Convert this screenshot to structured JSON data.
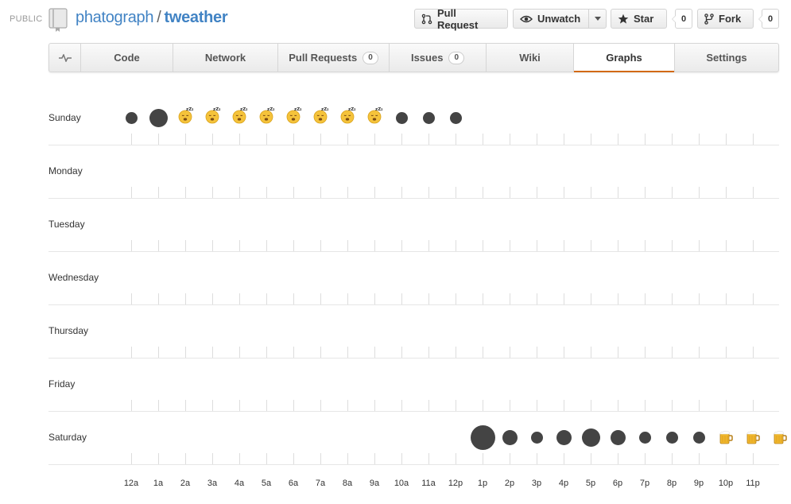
{
  "header": {
    "visibility": "PUBLIC",
    "owner": "phatograph",
    "separator": "/",
    "repo": "tweather",
    "actions": {
      "pull_request": "Pull Request",
      "unwatch": "Unwatch",
      "star": "Star",
      "star_count": "0",
      "fork": "Fork",
      "fork_count": "0"
    }
  },
  "tabs": [
    {
      "label": "",
      "icon": "pulse-icon",
      "count": null,
      "selected": false
    },
    {
      "label": "Code",
      "count": null,
      "selected": false
    },
    {
      "label": "Network",
      "count": null,
      "selected": false
    },
    {
      "label": "Pull Requests",
      "count": "0",
      "selected": false
    },
    {
      "label": "Issues",
      "count": "0",
      "selected": false
    },
    {
      "label": "Wiki",
      "count": null,
      "selected": false
    },
    {
      "label": "Graphs",
      "count": null,
      "selected": true
    },
    {
      "label": "Settings",
      "count": null,
      "selected": false
    }
  ],
  "colors": {
    "accent": "#4183c4",
    "selected_tab": "#d26911",
    "dot": "#444444"
  },
  "chart_data": {
    "type": "scatter",
    "days": [
      "Sunday",
      "Monday",
      "Tuesday",
      "Wednesday",
      "Thursday",
      "Friday",
      "Saturday"
    ],
    "hours": [
      "12a",
      "1a",
      "2a",
      "3a",
      "4a",
      "5a",
      "6a",
      "7a",
      "8a",
      "9a",
      "10a",
      "11a",
      "12p",
      "1p",
      "2p",
      "3p",
      "4p",
      "5p",
      "6p",
      "7p",
      "8p",
      "9p",
      "10p",
      "11p"
    ],
    "commits": [
      {
        "day": "Sunday",
        "hour": "12a",
        "size": 1,
        "marker": "dot"
      },
      {
        "day": "Sunday",
        "hour": "1a",
        "size": 2,
        "marker": "dot"
      },
      {
        "day": "Sunday",
        "hour": "2a",
        "marker": "sleeping-emoji"
      },
      {
        "day": "Sunday",
        "hour": "3a",
        "marker": "sleeping-emoji"
      },
      {
        "day": "Sunday",
        "hour": "4a",
        "marker": "sleeping-emoji"
      },
      {
        "day": "Sunday",
        "hour": "5a",
        "marker": "sleeping-emoji"
      },
      {
        "day": "Sunday",
        "hour": "6a",
        "marker": "sleeping-emoji"
      },
      {
        "day": "Sunday",
        "hour": "7a",
        "marker": "sleeping-emoji"
      },
      {
        "day": "Sunday",
        "hour": "8a",
        "marker": "sleeping-emoji"
      },
      {
        "day": "Sunday",
        "hour": "9a",
        "marker": "sleeping-emoji"
      },
      {
        "day": "Sunday",
        "hour": "10a",
        "size": 1,
        "marker": "dot"
      },
      {
        "day": "Sunday",
        "hour": "11a",
        "size": 1,
        "marker": "dot"
      },
      {
        "day": "Sunday",
        "hour": "12p",
        "size": 1,
        "marker": "dot"
      },
      {
        "day": "Saturday",
        "hour": "1p",
        "size": 3,
        "marker": "dot"
      },
      {
        "day": "Saturday",
        "hour": "2p",
        "size": 1.5,
        "marker": "dot"
      },
      {
        "day": "Saturday",
        "hour": "3p",
        "size": 1,
        "marker": "dot"
      },
      {
        "day": "Saturday",
        "hour": "4p",
        "size": 1.5,
        "marker": "dot"
      },
      {
        "day": "Saturday",
        "hour": "5p",
        "size": 2,
        "marker": "dot"
      },
      {
        "day": "Saturday",
        "hour": "6p",
        "size": 1.5,
        "marker": "dot"
      },
      {
        "day": "Saturday",
        "hour": "7p",
        "size": 1,
        "marker": "dot"
      },
      {
        "day": "Saturday",
        "hour": "8p",
        "size": 1,
        "marker": "dot"
      },
      {
        "day": "Saturday",
        "hour": "9p",
        "size": 1,
        "marker": "dot"
      },
      {
        "day": "Saturday",
        "hour": "10p",
        "marker": "beer-emoji"
      },
      {
        "day": "Saturday",
        "hour": "11p",
        "marker": "beer-emoji"
      },
      {
        "day": "Saturday",
        "hour": "11p+",
        "marker": "beer-emoji"
      }
    ]
  }
}
